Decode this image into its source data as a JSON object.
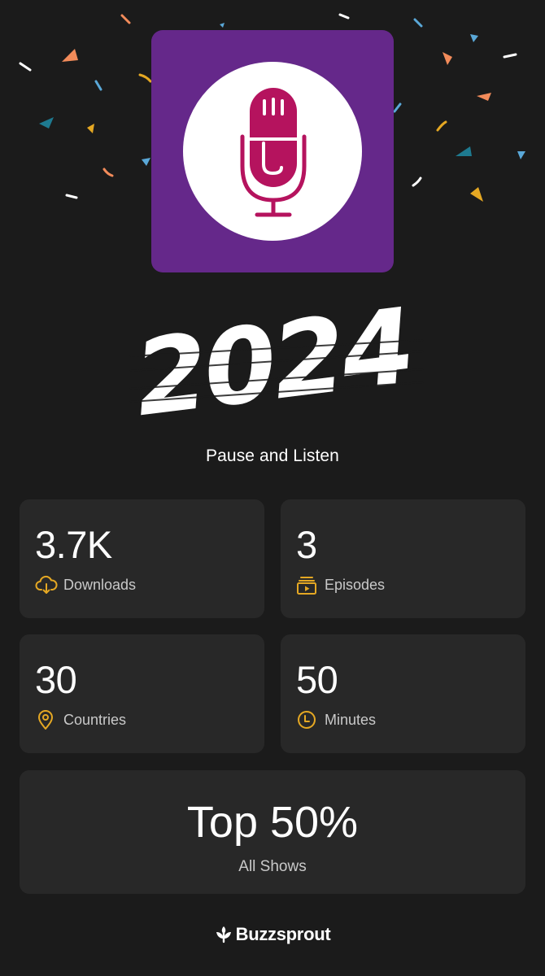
{
  "year_text": "2024",
  "show": {
    "title": "Pause and Listen"
  },
  "stats": [
    {
      "value": "3.7K",
      "label": "Downloads",
      "icon": "cloud-download-icon"
    },
    {
      "value": "3",
      "label": "Episodes",
      "icon": "episodes-icon"
    },
    {
      "value": "30",
      "label": "Countries",
      "icon": "location-pin-icon"
    },
    {
      "value": "50",
      "label": "Minutes",
      "icon": "clock-icon"
    }
  ],
  "ranking": {
    "value": "Top 50%",
    "label": "All Shows"
  },
  "footer": {
    "brand": "Buzzsprout",
    "icon": "buzzsprout-logo-icon"
  },
  "colors": {
    "background": "#1b1b1b",
    "card": "#282828",
    "accent": "#e5a823",
    "artwork_purple": "#65288a",
    "microphone": "#b5135e"
  }
}
